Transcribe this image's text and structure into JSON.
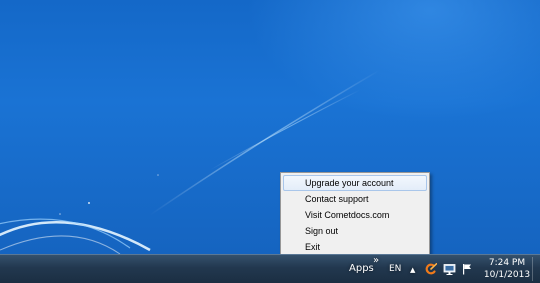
{
  "context_menu": {
    "items": [
      {
        "label": "Upgrade your account",
        "highlighted": true
      },
      {
        "label": "Contact support",
        "highlighted": false
      },
      {
        "label": "Visit Cometdocs.com",
        "highlighted": false
      },
      {
        "label": "Sign out",
        "highlighted": false
      },
      {
        "label": "Exit",
        "highlighted": false
      }
    ]
  },
  "taskbar": {
    "apps_label": "Apps",
    "overflow_chevron": "»",
    "language": "EN",
    "show_hidden_icons": "▲",
    "tray_icons": [
      "cometdocs-icon",
      "network-icon",
      "action-center-flag-icon"
    ],
    "clock": {
      "time": "7:24 PM",
      "date": "10/1/2013"
    }
  },
  "colors": {
    "desktop_blue": "#1a73d4",
    "taskbar": "#22384f",
    "menu_bg": "#f0f0f0",
    "menu_highlight_border": "#a9c6ea",
    "comet_orange": "#f07a1a"
  }
}
